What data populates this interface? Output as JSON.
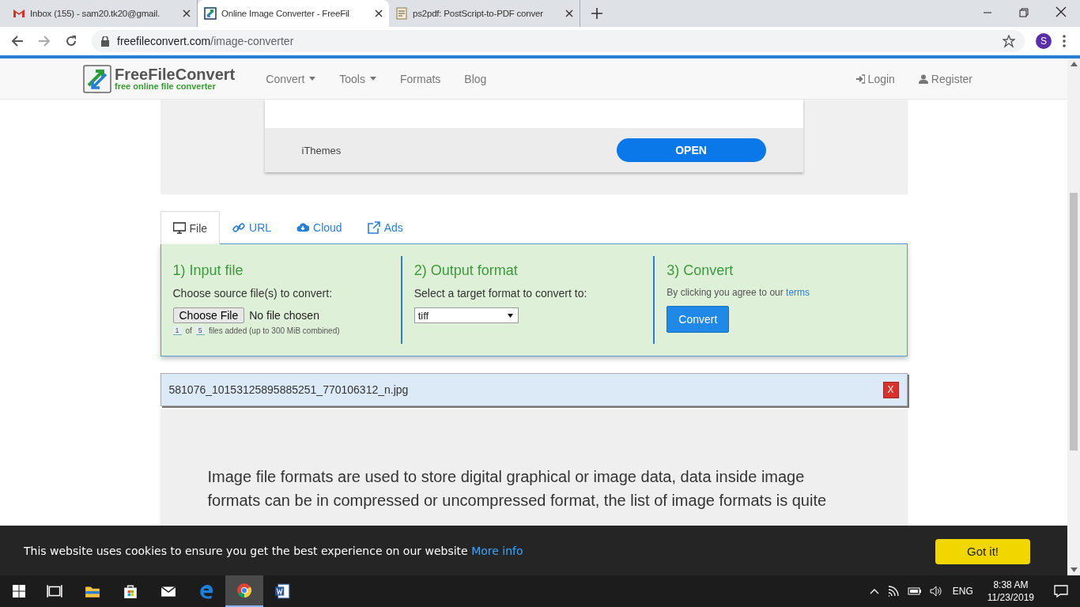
{
  "browser": {
    "tabs": [
      {
        "title": "Inbox (155) - sam20.tk20@gmail.",
        "kind": "mail",
        "selected": false
      },
      {
        "title": "Online Image Converter - FreeFil",
        "kind": "site",
        "selected": true
      },
      {
        "title": "ps2pdf: PostScript-to-PDF conver",
        "kind": "doc",
        "selected": false
      }
    ],
    "url": {
      "domain": "freefileconvert.com",
      "path": "/image-converter"
    },
    "profile": "S"
  },
  "site": {
    "logo": {
      "name": "FreeFileConvert",
      "tagline": "free online file converter"
    },
    "nav": [
      {
        "label": "Convert",
        "dropdown": true
      },
      {
        "label": "Tools",
        "dropdown": true
      },
      {
        "label": "Formats",
        "dropdown": false
      },
      {
        "label": "Blog",
        "dropdown": false
      }
    ],
    "auth": [
      {
        "label": "Login",
        "kind": "login"
      },
      {
        "label": "Register",
        "kind": "user"
      }
    ]
  },
  "ad": {
    "advertiser": "iThemes",
    "button": "OPEN"
  },
  "source_tabs": [
    {
      "label": "File",
      "kind": "monitor",
      "selected": true
    },
    {
      "label": "URL",
      "kind": "link",
      "selected": false
    },
    {
      "label": "Cloud",
      "kind": "cloud",
      "selected": false
    },
    {
      "label": "Ads",
      "kind": "external",
      "selected": false
    }
  ],
  "steps": {
    "input": {
      "title": "1) Input file",
      "prompt": "Choose source file(s) to convert:",
      "button": "Choose File",
      "status": "No file chosen",
      "count": "1",
      "of": "of",
      "max": "5",
      "note": "files added (up to 300 MiB combined)"
    },
    "output": {
      "title": "2) Output format",
      "prompt": "Select a target format to convert to:",
      "format": "tiff"
    },
    "convert": {
      "title": "3) Convert",
      "note": "By clicking you agree to our",
      "link": "terms",
      "button": "Convert"
    }
  },
  "file_item": {
    "name": "581076_10153125895885251_770106312_n.jpg",
    "remove": "X"
  },
  "article": {
    "lines": [
      "Image file formats are used to store digital graphical or image data, data inside image",
      "formats can be in compressed or uncompressed format, the list of image formats is quite"
    ]
  },
  "cookie": {
    "message": "This website uses cookies to ensure you get the best experience on our website",
    "link": "More info",
    "button": "Got it!"
  },
  "taskbar": {
    "apps": [
      {
        "kind": "taskview",
        "active": false
      },
      {
        "kind": "folder",
        "active": false
      },
      {
        "kind": "store",
        "active": false
      },
      {
        "kind": "mail",
        "active": false
      },
      {
        "kind": "edge",
        "active": false
      },
      {
        "kind": "chrome",
        "active": true
      },
      {
        "kind": "word",
        "active": false
      }
    ],
    "language": "ENG",
    "time": "8:38 AM",
    "date": "11/23/2019"
  }
}
